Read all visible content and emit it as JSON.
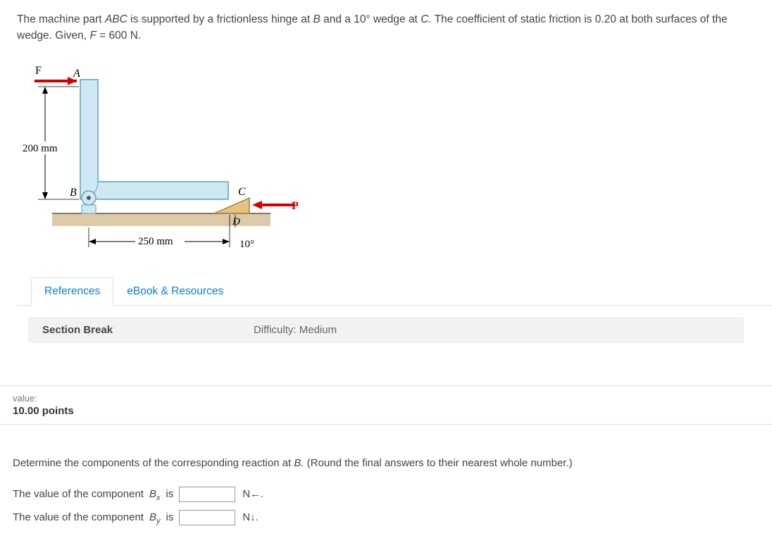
{
  "problem": {
    "pre": "The machine part ",
    "abc": "ABC",
    "mid1": " is supported by a frictionless hinge at ",
    "B": "B",
    "mid2": " and a 10° wedge at ",
    "C": "C.",
    "mid3": " The coefficient of static friction is 0.20 at both surfaces of the wedge. Given, ",
    "Feq": "F",
    "mid4": " = 600 N."
  },
  "figure": {
    "F": "F",
    "A": "A",
    "B": "B",
    "C": "C",
    "D": "D",
    "P": "P",
    "dim_v": "200 mm",
    "dim_h": "250 mm",
    "angle": "10°"
  },
  "tabs": {
    "references": "References",
    "ebook": "eBook & Resources"
  },
  "section": {
    "label": "Section Break",
    "difficulty": "Difficulty: Medium"
  },
  "points": {
    "label": "value:",
    "value": "10.00 points"
  },
  "question": {
    "prompt_pre": "Determine the components of the corresponding reaction at ",
    "prompt_B": "B.",
    "prompt_post": " (Round the final answers to their nearest whole number.)",
    "row1_pre": "The value of the component ",
    "row1_B": "B",
    "row1_sub": "x",
    "row1_is": "  is",
    "row1_unit": "N←.",
    "row2_pre": "The value of the component ",
    "row2_B": "B",
    "row2_sub": "y",
    "row2_is": "  is",
    "row2_unit": "N↓."
  }
}
